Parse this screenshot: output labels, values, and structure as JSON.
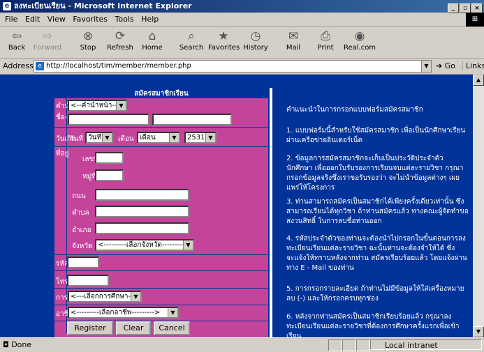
{
  "window": {
    "title": "ลงทะเบียนเรียน - Microsoft Internet Explorer"
  },
  "menu": [
    "File",
    "Edit",
    "View",
    "Favorites",
    "Tools",
    "Help"
  ],
  "toolbar": [
    {
      "label": "Back",
      "icon": "back-arrow-icon",
      "glyph": "⇦"
    },
    {
      "label": "Forward",
      "icon": "forward-arrow-icon",
      "glyph": "⇨"
    },
    {
      "label": "Stop",
      "icon": "stop-icon",
      "glyph": "⊗"
    },
    {
      "label": "Refresh",
      "icon": "refresh-icon",
      "glyph": "⟳"
    },
    {
      "label": "Home",
      "icon": "home-icon",
      "glyph": "⌂"
    },
    {
      "label": "Search",
      "icon": "search-icon",
      "glyph": "⌕"
    },
    {
      "label": "Favorites",
      "icon": "favorites-icon",
      "glyph": "★"
    },
    {
      "label": "History",
      "icon": "history-icon",
      "glyph": "◷"
    },
    {
      "label": "Mail",
      "icon": "mail-icon",
      "glyph": "✉"
    },
    {
      "label": "Print",
      "icon": "print-icon",
      "glyph": "⎙"
    },
    {
      "label": "Real.com",
      "icon": "real-icon",
      "glyph": "◉"
    }
  ],
  "address": {
    "label": "Address",
    "url": "http://localhost/tim/member/member.php",
    "go": "Go",
    "links": "Links"
  },
  "form": {
    "heading": "สมัครสมาชิกเรียน",
    "prefix_label": "คำนำหน้า",
    "prefix_value": "<--คำนำหน้า-->",
    "name_label": "ชื่อ-สกุล",
    "birth_label": "วันเกิด",
    "day_label": "วันที่",
    "day_value": "วันที่",
    "month_label": "เดือน",
    "month_value": "เดือน",
    "year_value": "2531",
    "address_label": "ที่อยู่",
    "house_label": "เลขที่",
    "moo_label": "หมู่ที่",
    "road_label": "ถนน",
    "subdistrict_label": "ตำบล",
    "district_label": "อำเภอ",
    "province_label": "จังหวัด",
    "province_value": "<---------เลือกจังหวัด--------->",
    "postcode_label": "รหัสไปรษณีย์",
    "phone_label": "โทรศัพท์",
    "education_label": "การศึกษาสูงสุด",
    "education_value": "<---เลือกการศึกษา--->",
    "job_label": "อาชีพ",
    "job_value": "<---------เลือกอาชีพ--------->",
    "register": "Register",
    "clear": "Clear",
    "cancel": "Cancel"
  },
  "instructions": {
    "title": "คำแนะนำในการกรอกแบบฟอร์มสมัครสมาชิก",
    "items": [
      "1. แบบฟอร์มนี้สำหรับใช้สมัครสมาชิก เพื่อเป็นนักศึกษาเรียนผ่านเครือข่ายอินเตอร์เน็ต",
      "2. ข้อมูลการสมัครสมาชิกจะเก็บเป็นประวัติประจำตัวนักศึกษา เพื่อออกใบรับรองการเรียนจบแต่ละรายวิชา กรุณากรอกข้อมูลจริงซึ่งเราขอรับรองว่า จะไม่นำข้อมูลต่างๆ เผยแพร่ให้โครงการ",
      "3. ท่านสามารถสมัครเป็นสมาชิกได้เพียงครั้งเดียวเท่านั้น ซึ่งสามารถเรียนได้ทุกวิชา ถ้าท่านสมัครแล้ว ทางคณะผู้จัดทำขอสงวนสิทธิ์ ในการลบชื่อท่านออก",
      "4. รหัสประจำตัวของท่านจะต้องนำไปกรอกในขั้นตอนการลงทะเบียนเรียนแต่ละรายวิชา ฉะนั้นท่านจะต้องจำให้ได้ ซึ่งจะแจ้งให้ทราบหลังจากท่าน สมัครเรียบร้อยแล้ว โดยแจ้งผ่านทาง E - Mail ของท่าน",
      "5. การกรอกรายละเอียด ถ้าท่านไม่มีข้อมูลให้ใส่เครื่องหมายลบ (-) และให้กรอกครบทุกช่อง",
      "6. หลังจากท่านสมัครเป็นสมาชิกเรียบร้อยแล้ว กรุณาลงทะเบียนเรียนแต่ละรายวิชาที่ต้องการศึกษาครั้งแรกเพื่อเข้าเรียน"
    ]
  },
  "status": {
    "text": "Done",
    "zone": "Local intranet"
  }
}
